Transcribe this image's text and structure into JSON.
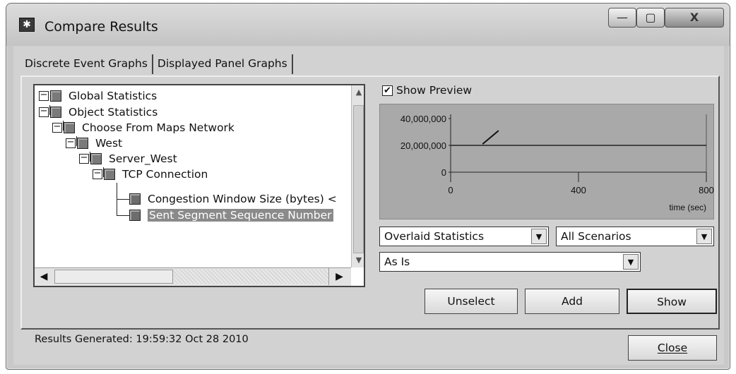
{
  "window": {
    "title": "Compare Results",
    "controls": {
      "minimize": "—",
      "maximize": "▢",
      "close": "X"
    }
  },
  "tabs": [
    {
      "label": "Discrete Event Graphs",
      "active": true
    },
    {
      "label": "Displayed Panel Graphs",
      "active": false
    }
  ],
  "tree": {
    "items": [
      {
        "label": "Global Statistics",
        "expander": "−"
      },
      {
        "label": "Object Statistics",
        "expander": "−"
      },
      {
        "label": "Choose From Maps Network",
        "expander": "−"
      },
      {
        "label": "West",
        "expander": "−"
      },
      {
        "label": "Server_West",
        "expander": "−"
      },
      {
        "label": "TCP Connection",
        "expander": "−"
      },
      {
        "label": "Congestion Window Size (bytes) <"
      },
      {
        "label": "Sent Segment Sequence Number",
        "selected": true
      }
    ]
  },
  "preview": {
    "checkbox_label": "Show Preview",
    "checked": true
  },
  "chart_data": {
    "type": "line",
    "y_tick_labels": [
      "40,000,000",
      "20,000,000",
      "0"
    ],
    "x_tick_labels": [
      "0",
      "400",
      "800"
    ],
    "xlabel": "time (sec)",
    "xlim": [
      0,
      800
    ],
    "ylim": [
      0,
      40000000
    ],
    "series": [
      {
        "x": [
          100,
          150
        ],
        "y": [
          21000000,
          31000000
        ]
      }
    ],
    "reference_line_y": 20000000
  },
  "controls": {
    "statistics_mode": "Overlaid Statistics",
    "scenarios": "All Scenarios",
    "filter": "As Is"
  },
  "buttons": {
    "unselect": "Unselect",
    "add": "Add",
    "show": "Show",
    "close": "Close"
  },
  "status": {
    "results_generated": "Results Generated: 19:59:32 Oct 28 2010"
  }
}
